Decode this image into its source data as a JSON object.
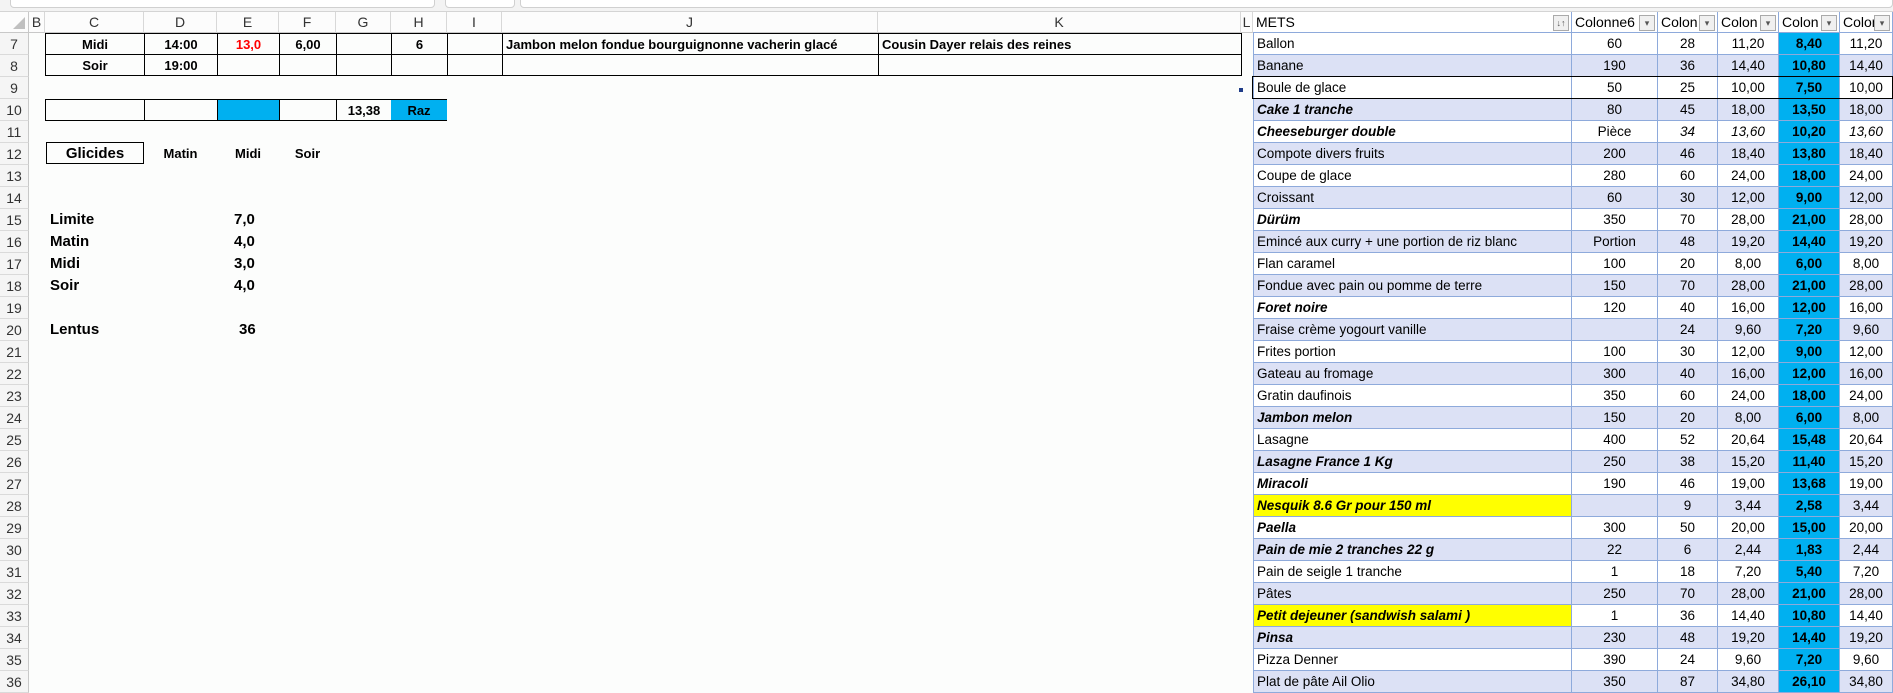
{
  "columns": [
    "B",
    "C",
    "D",
    "E",
    "F",
    "G",
    "H",
    "I",
    "J",
    "K",
    "L"
  ],
  "row_numbers": [
    7,
    8,
    9,
    10,
    11,
    12,
    13,
    14,
    15,
    16,
    17,
    18,
    19,
    20,
    21,
    22,
    23,
    24,
    25,
    26,
    27,
    28,
    29,
    30,
    31,
    32,
    33,
    34,
    35,
    36
  ],
  "schedule": {
    "row7": {
      "meal": "Midi",
      "time": "14:00",
      "e": "13,0",
      "f": "6,00",
      "h": "6",
      "menu": "Jambon melon fondue bourguignonne vacherin glacé",
      "place": "Cousin Dayer relais des reines"
    },
    "row8": {
      "meal": "Soir",
      "time": "19:00"
    },
    "row10": {
      "total": "13,38",
      "raz_label": "Raz"
    },
    "accent_red": "#ff0000",
    "accent_blue": "#00b0f0"
  },
  "glucides": {
    "title": "Glicides",
    "headers": [
      "Matin",
      "Midi",
      "Soir"
    ],
    "items": [
      {
        "label": "Limite",
        "value": "7,0"
      },
      {
        "label": "Matin",
        "value": "4,0"
      },
      {
        "label": "Midi",
        "value": "3,0"
      },
      {
        "label": "Soir",
        "value": "4,0"
      }
    ],
    "lentus": {
      "label": "Lentus",
      "value": "36"
    }
  },
  "table": {
    "headers": [
      "METS",
      "Colonne6",
      "Colon",
      "Colon",
      "Colon",
      "Colon"
    ],
    "row_stripe": "#dce1f5",
    "highlight": "#ffff00",
    "grid": "#8eaadb",
    "rows": [
      {
        "name": "Ballon",
        "v": [
          "60",
          "28",
          "11,20",
          "8,40",
          "11,20"
        ]
      },
      {
        "name": "Banane",
        "v": [
          "190",
          "36",
          "14,40",
          "10,80",
          "14,40"
        ]
      },
      {
        "name": "Boule de glace",
        "v": [
          "50",
          "25",
          "10,00",
          "7,50",
          "10,00"
        ],
        "selected": true
      },
      {
        "name": "Cake  1 tranche",
        "v": [
          "80",
          "45",
          "18,00",
          "13,50",
          "18,00"
        ],
        "bi": true
      },
      {
        "name": "Cheeseburger double",
        "v": [
          "Pièce",
          "34",
          "13,60",
          "10,20",
          "13,60"
        ],
        "bi": true,
        "italic_vals": true
      },
      {
        "name": "Compote divers fruits",
        "v": [
          "200",
          "46",
          "18,40",
          "13,80",
          "18,40"
        ]
      },
      {
        "name": "Coupe de glace",
        "v": [
          "280",
          "60",
          "24,00",
          "18,00",
          "24,00"
        ]
      },
      {
        "name": "Croissant",
        "v": [
          "60",
          "30",
          "12,00",
          "9,00",
          "12,00"
        ]
      },
      {
        "name": "Dürüm",
        "v": [
          "350",
          "70",
          "28,00",
          "21,00",
          "28,00"
        ],
        "bi": true
      },
      {
        "name": "Emincé aux curry  + une portion de riz blanc",
        "v": [
          "Portion",
          "48",
          "19,20",
          "14,40",
          "19,20"
        ]
      },
      {
        "name": "Flan caramel",
        "v": [
          "100",
          "20",
          "8,00",
          "6,00",
          "8,00"
        ]
      },
      {
        "name": "Fondue avec pain ou pomme de terre",
        "v": [
          "150",
          "70",
          "28,00",
          "21,00",
          "28,00"
        ]
      },
      {
        "name": "Foret noire",
        "v": [
          "120",
          "40",
          "16,00",
          "12,00",
          "16,00"
        ],
        "bi": true
      },
      {
        "name": "Fraise crème yogourt vanille",
        "v": [
          "",
          "24",
          "9,60",
          "7,20",
          "9,60"
        ]
      },
      {
        "name": "Frites portion",
        "v": [
          "100",
          "30",
          "12,00",
          "9,00",
          "12,00"
        ]
      },
      {
        "name": "Gateau au fromage",
        "v": [
          "300",
          "40",
          "16,00",
          "12,00",
          "16,00"
        ]
      },
      {
        "name": "Gratin daufinois",
        "v": [
          "350",
          "60",
          "24,00",
          "18,00",
          "24,00"
        ]
      },
      {
        "name": "Jambon melon",
        "v": [
          "150",
          "20",
          "8,00",
          "6,00",
          "8,00"
        ],
        "bi": true
      },
      {
        "name": "Lasagne",
        "v": [
          "400",
          "52",
          "20,64",
          "15,48",
          "20,64"
        ]
      },
      {
        "name": "Lasagne France   1 Kg",
        "v": [
          "250",
          "38",
          "15,20",
          "11,40",
          "15,20"
        ],
        "bi": true
      },
      {
        "name": "Miracoli",
        "v": [
          "190",
          "46",
          "19,00",
          "13,68",
          "19,00"
        ],
        "bi": true
      },
      {
        "name": "Nesquik  8.6 Gr pour 150 ml",
        "v": [
          "",
          "9",
          "3,44",
          "2,58",
          "3,44"
        ],
        "bi": true,
        "yellow": true
      },
      {
        "name": "Paella",
        "v": [
          "300",
          "50",
          "20,00",
          "15,00",
          "20,00"
        ],
        "bi": true
      },
      {
        "name": "Pain de mie 2 tranches  22 g",
        "v": [
          "22",
          "6",
          "2,44",
          "1,83",
          "2,44"
        ],
        "bi": true
      },
      {
        "name": "Pain de seigle  1 tranche",
        "v": [
          "1",
          "18",
          "7,20",
          "5,40",
          "7,20"
        ]
      },
      {
        "name": "Pâtes",
        "v": [
          "250",
          "70",
          "28,00",
          "21,00",
          "28,00"
        ]
      },
      {
        "name": "Petit dejeuner (sandwish salami )",
        "v": [
          "1",
          "36",
          "14,40",
          "10,80",
          "14,40"
        ],
        "bi": true,
        "yellow": true
      },
      {
        "name": "Pinsa",
        "v": [
          "230",
          "48",
          "19,20",
          "14,40",
          "19,20"
        ],
        "bi": true
      },
      {
        "name": "Pizza Denner",
        "v": [
          "390",
          "24",
          "9,60",
          "7,20",
          "9,60"
        ]
      },
      {
        "name": "Plat de pâte Ail Olio",
        "v": [
          "350",
          "87",
          "34,80",
          "26,10",
          "34,80"
        ]
      }
    ]
  }
}
